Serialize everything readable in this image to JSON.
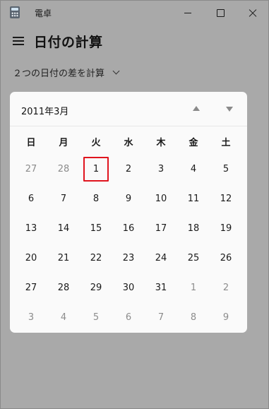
{
  "window": {
    "title": "電卓"
  },
  "header": {
    "page_title": "日付の計算",
    "mode": "２つの日付の差を計算"
  },
  "calendar": {
    "month_label": "2011年3月",
    "weekdays": [
      "日",
      "月",
      "火",
      "水",
      "木",
      "金",
      "土"
    ],
    "days": [
      {
        "n": "27",
        "other": true
      },
      {
        "n": "28",
        "other": true
      },
      {
        "n": "1",
        "selected": true
      },
      {
        "n": "2"
      },
      {
        "n": "3"
      },
      {
        "n": "4"
      },
      {
        "n": "5"
      },
      {
        "n": "6"
      },
      {
        "n": "7"
      },
      {
        "n": "8"
      },
      {
        "n": "9"
      },
      {
        "n": "10"
      },
      {
        "n": "11"
      },
      {
        "n": "12"
      },
      {
        "n": "13"
      },
      {
        "n": "14"
      },
      {
        "n": "15"
      },
      {
        "n": "16"
      },
      {
        "n": "17"
      },
      {
        "n": "18"
      },
      {
        "n": "19"
      },
      {
        "n": "20"
      },
      {
        "n": "21"
      },
      {
        "n": "22"
      },
      {
        "n": "23"
      },
      {
        "n": "24"
      },
      {
        "n": "25"
      },
      {
        "n": "26"
      },
      {
        "n": "27"
      },
      {
        "n": "28"
      },
      {
        "n": "29"
      },
      {
        "n": "30"
      },
      {
        "n": "31"
      },
      {
        "n": "1",
        "other": true
      },
      {
        "n": "2",
        "other": true
      },
      {
        "n": "3",
        "other": true
      },
      {
        "n": "4",
        "other": true
      },
      {
        "n": "5",
        "other": true
      },
      {
        "n": "6",
        "other": true
      },
      {
        "n": "7",
        "other": true
      },
      {
        "n": "8",
        "other": true
      },
      {
        "n": "9",
        "other": true
      }
    ]
  },
  "icons": {
    "app": "calculator-icon",
    "menu": "hamburger-menu-icon",
    "mode_dropdown": "chevron-down-icon",
    "prev_month": "triangle-up-icon",
    "next_month": "triangle-down-icon"
  },
  "colors": {
    "selection": "#e0141e",
    "backdrop": "#a9a9a9",
    "calendar_bg": "#fafafa"
  }
}
